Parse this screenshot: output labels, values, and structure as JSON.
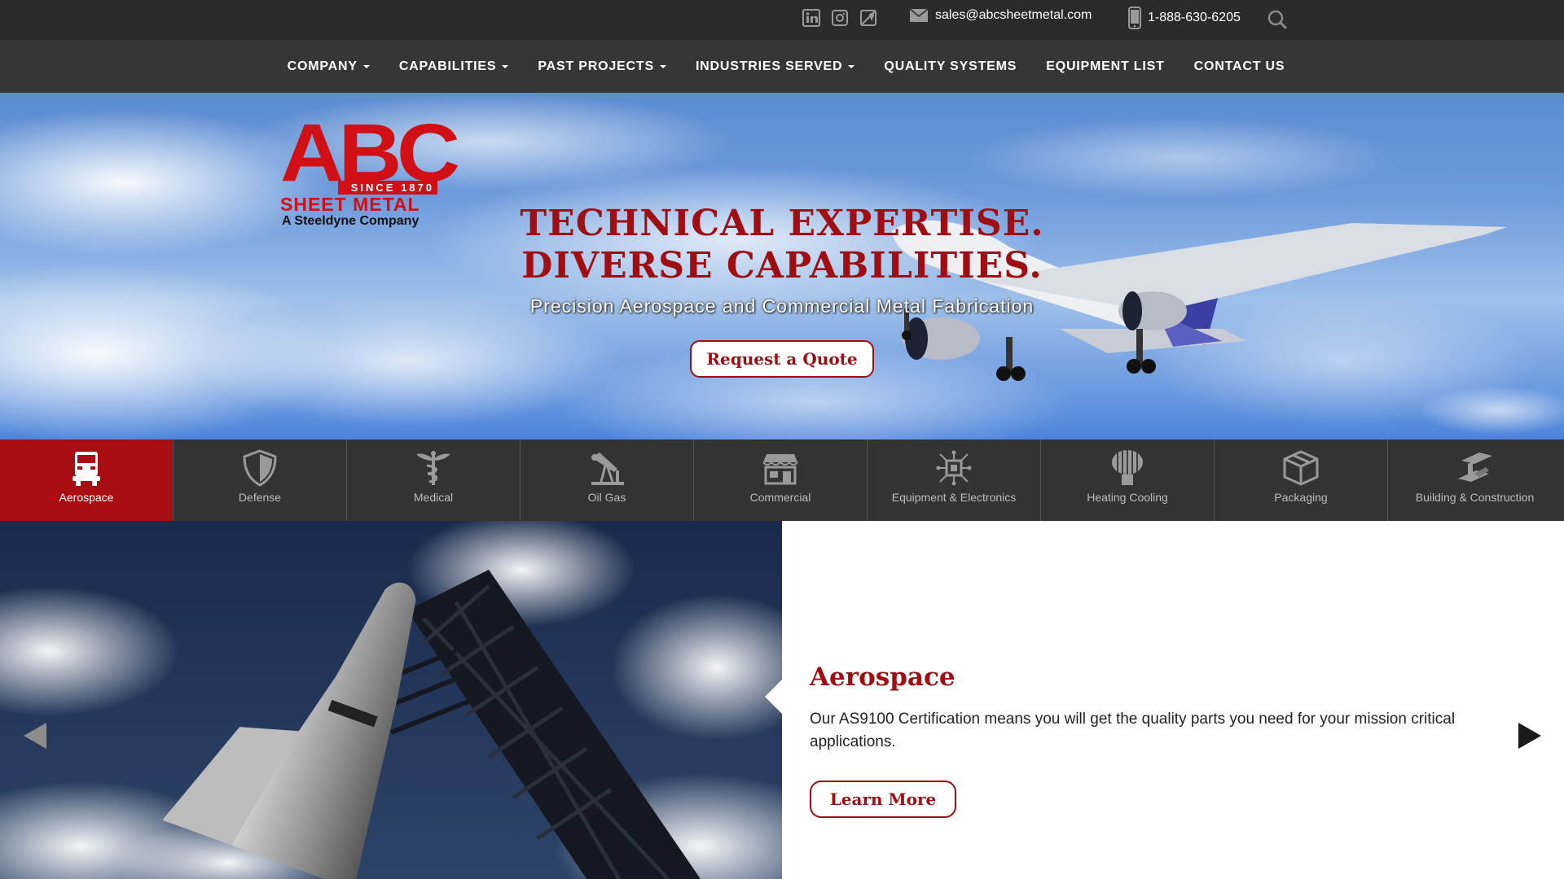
{
  "topbar": {
    "social": [
      {
        "name": "linkedin-icon"
      },
      {
        "name": "instagram-icon"
      },
      {
        "name": "map-icon"
      }
    ],
    "email": "sales@abcsheetmetal.com",
    "phone": "1-888-630-6205"
  },
  "nav": {
    "items": [
      {
        "label": "COMPANY",
        "dropdown": true
      },
      {
        "label": "CAPABILITIES",
        "dropdown": true
      },
      {
        "label": "PAST PROJECTS",
        "dropdown": true
      },
      {
        "label": "INDUSTRIES SERVED",
        "dropdown": true
      },
      {
        "label": "QUALITY SYSTEMS",
        "dropdown": false
      },
      {
        "label": "EQUIPMENT LIST",
        "dropdown": false
      },
      {
        "label": "CONTACT US",
        "dropdown": false
      }
    ]
  },
  "logo": {
    "main": "ABC",
    "since": "SINCE 1870",
    "line1": "SHEET METAL",
    "line2": "A Steeldyne Company"
  },
  "hero": {
    "title_line1": "TECHNICAL EXPERTISE.",
    "title_line2": "DIVERSE CAPABILITIES.",
    "subtitle": "Precision Aerospace and Commercial Metal Fabrication",
    "cta": "Request a Quote"
  },
  "industries": [
    {
      "label": "Aerospace",
      "icon": "truck-icon",
      "active": true
    },
    {
      "label": "Defense",
      "icon": "shield-icon",
      "active": false
    },
    {
      "label": "Medical",
      "icon": "caduceus-icon",
      "active": false
    },
    {
      "label": "Oil Gas",
      "icon": "oil-pump-icon",
      "active": false
    },
    {
      "label": "Commercial",
      "icon": "storefront-icon",
      "active": false
    },
    {
      "label": "Equipment & Electronics",
      "icon": "circuit-icon",
      "active": false
    },
    {
      "label": "Heating Cooling",
      "icon": "vent-icon",
      "active": false
    },
    {
      "label": "Packaging",
      "icon": "box-icon",
      "active": false
    },
    {
      "label": "Building & Construction",
      "icon": "beam-icon",
      "active": false
    }
  ],
  "feature": {
    "title": "Aerospace",
    "text": "Our AS9100 Certification means you will get the quality parts you need for your mission critical applications.",
    "button": "Learn More"
  },
  "colors": {
    "brand_red": "#9e0e12",
    "topbar": "#2b2b2b",
    "nav": "#363636",
    "tabs": "#333333"
  }
}
